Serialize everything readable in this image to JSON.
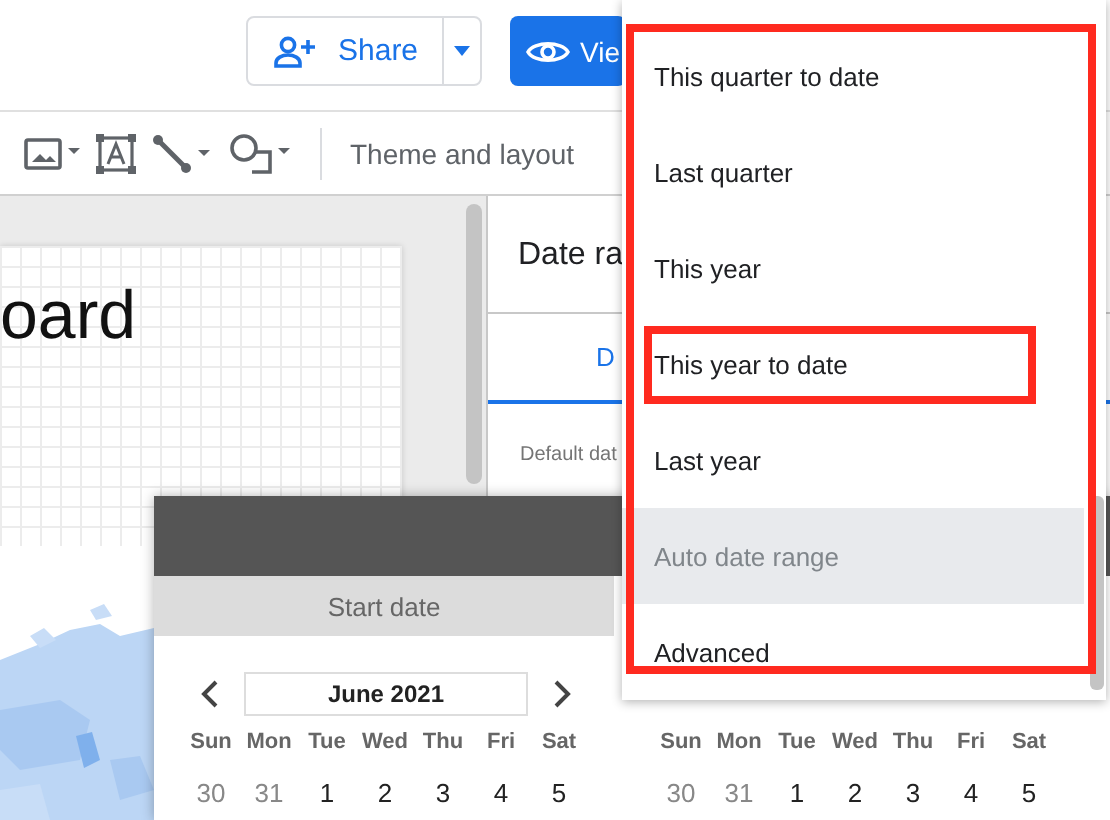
{
  "top_bar": {
    "share_button": {
      "label": "Share"
    },
    "view_button": {
      "label": "Vie"
    }
  },
  "toolbar": {
    "theme_button": {
      "label": "Theme and layout"
    }
  },
  "canvas": {
    "title": "oard"
  },
  "panel": {
    "title": "Date ra",
    "tabs": [
      {
        "label": "D",
        "selected": true
      }
    ],
    "field_label": "Default dat"
  },
  "date_popup": {
    "start_label": "Start date",
    "calendars": [
      {
        "month": "June 2021",
        "weekdays": [
          "Sun",
          "Mon",
          "Tue",
          "Wed",
          "Thu",
          "Fri",
          "Sat"
        ],
        "days": [
          {
            "label": "30",
            "outside": true
          },
          {
            "label": "31",
            "outside": true
          },
          {
            "label": "1",
            "outside": false
          },
          {
            "label": "2",
            "outside": false
          },
          {
            "label": "3",
            "outside": false
          },
          {
            "label": "4",
            "outside": false
          },
          {
            "label": "5",
            "outside": false
          }
        ]
      },
      {
        "weekdays": [
          "Sun",
          "Mon",
          "Tue",
          "Wed",
          "Thu",
          "Fri",
          "Sat"
        ],
        "days": [
          {
            "label": "30",
            "outside": true
          },
          {
            "label": "31",
            "outside": true
          },
          {
            "label": "1",
            "outside": false
          },
          {
            "label": "2",
            "outside": false
          },
          {
            "label": "3",
            "outside": false
          },
          {
            "label": "4",
            "outside": false
          },
          {
            "label": "5",
            "outside": false
          }
        ]
      }
    ]
  },
  "menu": {
    "outlined": true,
    "items": [
      {
        "label": "This quarter to date",
        "selected": false,
        "outlined": false
      },
      {
        "label": "Last quarter",
        "selected": false,
        "outlined": false
      },
      {
        "label": "This year",
        "selected": false,
        "outlined": false
      },
      {
        "label": "This year to date",
        "selected": false,
        "outlined": true
      },
      {
        "label": "Last year",
        "selected": false,
        "outlined": false
      },
      {
        "label": "Auto date range",
        "selected": true,
        "outlined": false
      },
      {
        "label": "Advanced",
        "selected": false,
        "outlined": false
      }
    ]
  }
}
